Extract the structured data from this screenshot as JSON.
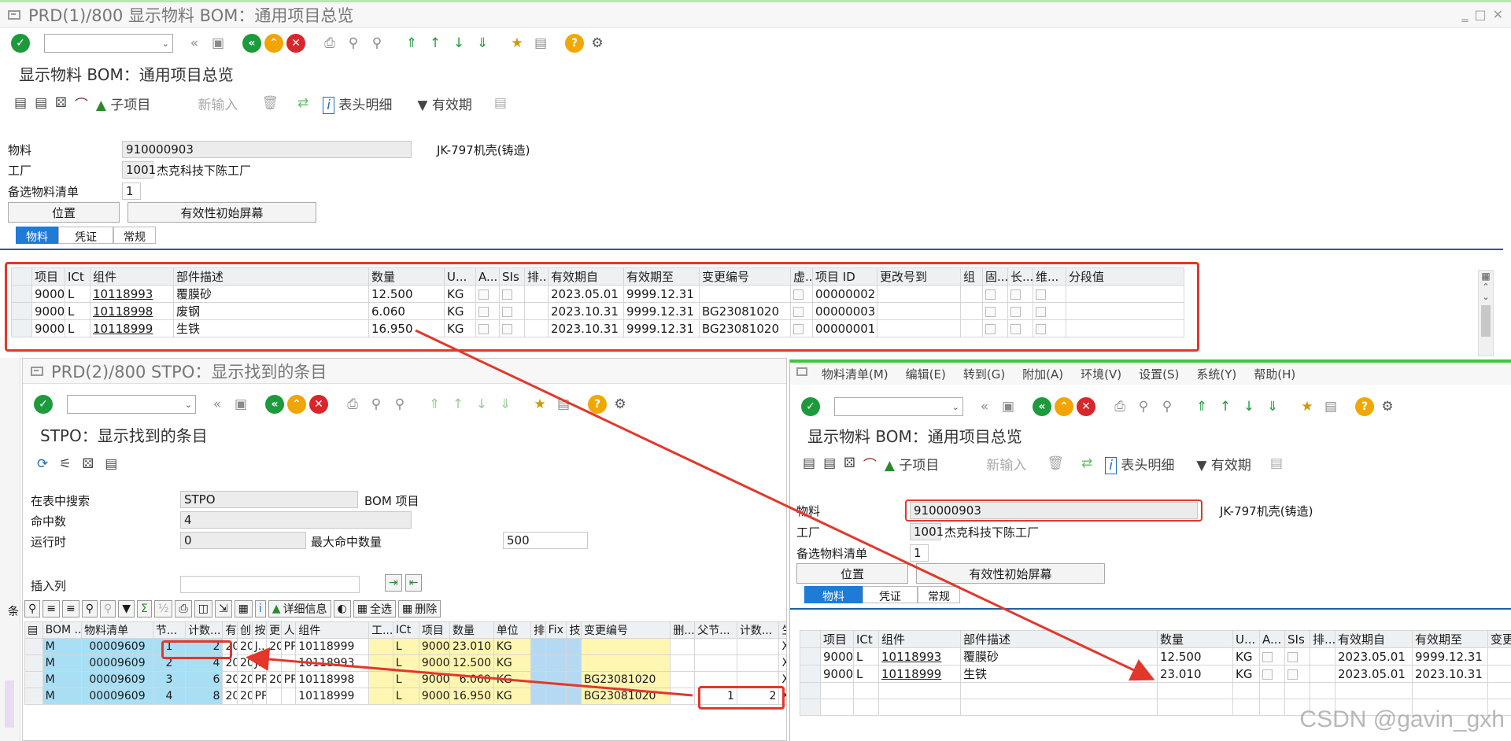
{
  "win1": {
    "title": "PRD(1)/800 显示物料 BOM：通用项目总览",
    "page_title": "显示物料 BOM：通用项目总览",
    "app_toolbar": {
      "sub_item": "子项目",
      "new_entry": "新输入",
      "header_detail": "表头明细",
      "validity": "有效期"
    },
    "material_label": "物料",
    "material_value": "910000903",
    "material_desc": "JK-797机壳(铸造)",
    "plant_label": "工厂",
    "plant_value": "1001",
    "plant_desc": "杰克科技下陈工厂",
    "alt_bom_label": "备选物料清单",
    "alt_bom_value": "1",
    "btn_position": "位置",
    "btn_validity": "有效性初始屏幕",
    "tabs": [
      "物料",
      "凭证",
      "常规"
    ],
    "columns": [
      "项目",
      "ICt",
      "组件",
      "部件描述",
      "数量",
      "U...",
      "A...",
      "SIs",
      "排...",
      "有效期自",
      "有效期至",
      "变更编号",
      "虚...",
      "项目 ID",
      "更改号到",
      "组",
      "固...",
      "长...",
      "维...",
      "分段值"
    ],
    "rows": [
      {
        "item": "9000",
        "ict": "L",
        "comp": "10118993",
        "desc": "覆膜砂",
        "qty": "12.500",
        "unit": "KG",
        "from": "2023.05.01",
        "to": "9999.12.31",
        "change": "",
        "id": "00000002"
      },
      {
        "item": "9000",
        "ict": "L",
        "comp": "10118998",
        "desc": "废钢",
        "qty": "6.060",
        "unit": "KG",
        "from": "2023.10.31",
        "to": "9999.12.31",
        "change": "BG23081020",
        "id": "00000003"
      },
      {
        "item": "9000",
        "ict": "L",
        "comp": "10118999",
        "desc": "生铁",
        "qty": "16.950",
        "unit": "KG",
        "from": "2023.10.31",
        "to": "9999.12.31",
        "change": "BG23081020",
        "id": "00000001"
      }
    ],
    "side_label": "条"
  },
  "win2": {
    "title": "PRD(2)/800 STPO：显示找到的条目",
    "page_title": "STPO：显示找到的条目",
    "search_table_label": "在表中搜索",
    "search_table_value": "STPO",
    "search_table_desc": "BOM 项目",
    "hits_label": "命中数",
    "hits_value": "4",
    "runtime_label": "运行时",
    "runtime_value": "0",
    "max_hits_label": "最大命中数量",
    "max_hits_value": "500",
    "insert_col_label": "插入列",
    "grid_buttons": {
      "detail": "详细信息",
      "select_all": "全选",
      "delete": "删除"
    },
    "columns": [
      "BOM ...",
      "物料清单",
      "节...",
      "计数...",
      "有",
      "创",
      "按",
      "更",
      "人",
      "组件",
      "工...",
      "ICt",
      "项目",
      "数量",
      "单位",
      "排",
      "Fix",
      "技",
      "变更编号",
      "删...",
      "父节...",
      "计数...",
      "生"
    ],
    "rows": [
      {
        "bom": "M",
        "list": "00009609",
        "node": "1",
        "count": "2",
        "c1": "20",
        "c2": "20",
        "c3": "J..",
        "c4": "20",
        "c5": "PP",
        "comp": "10118999",
        "ict": "L",
        "item": "9000",
        "qty": "23.010",
        "unit": "KG",
        "change": "",
        "parent": "",
        "pcount": "",
        "x": "X"
      },
      {
        "bom": "M",
        "list": "00009609",
        "node": "2",
        "count": "4",
        "c1": "20",
        "c2": "20",
        "c3": "J..",
        "c4": "",
        "c5": "",
        "comp": "10118993",
        "ict": "L",
        "item": "9000",
        "qty": "12.500",
        "unit": "KG",
        "change": "",
        "parent": "",
        "pcount": "",
        "x": "X"
      },
      {
        "bom": "M",
        "list": "00009609",
        "node": "3",
        "count": "6",
        "c1": "20",
        "c2": "20",
        "c3": "PP",
        "c4": "20",
        "c5": "PP",
        "comp": "10118998",
        "ict": "L",
        "item": "9000",
        "qty": "6.060",
        "unit": "KG",
        "change": "BG23081020",
        "parent": "",
        "pcount": "",
        "x": "X"
      },
      {
        "bom": "M",
        "list": "00009609",
        "node": "4",
        "count": "8",
        "c1": "20",
        "c2": "20",
        "c3": "PP",
        "c4": "",
        "c5": "",
        "comp": "10118999",
        "ict": "L",
        "item": "9000",
        "qty": "16.950",
        "unit": "KG",
        "change": "BG23081020",
        "parent": "1",
        "pcount": "2",
        "x": "X"
      }
    ]
  },
  "win3": {
    "menu": [
      "物料清单(M)",
      "编辑(E)",
      "转到(G)",
      "附加(A)",
      "环境(V)",
      "设置(S)",
      "系统(Y)",
      "帮助(H)"
    ],
    "page_title": "显示物料 BOM：通用项目总览",
    "app_toolbar": {
      "sub_item": "子项目",
      "new_entry": "新输入",
      "header_detail": "表头明细",
      "validity": "有效期"
    },
    "material_label": "物料",
    "material_value": "910000903",
    "material_desc": "JK-797机壳(铸造)",
    "plant_label": "工厂",
    "plant_value": "1001",
    "plant_desc": "杰克科技下陈工厂",
    "alt_bom_label": "备选物料清单",
    "alt_bom_value": "1",
    "btn_position": "位置",
    "btn_validity": "有效性初始屏幕",
    "tabs": [
      "物料",
      "凭证",
      "常规"
    ],
    "columns": [
      "项目",
      "ICt",
      "组件",
      "部件描述",
      "数量",
      "U...",
      "A...",
      "SIs",
      "排...",
      "有效期自",
      "有效期至",
      "变更"
    ],
    "rows": [
      {
        "item": "9000",
        "ict": "L",
        "comp": "10118993",
        "desc": "覆膜砂",
        "qty": "12.500",
        "unit": "KG",
        "from": "2023.05.01",
        "to": "9999.12.31"
      },
      {
        "item": "9000",
        "ict": "L",
        "comp": "10118999",
        "desc": "生铁",
        "qty": "23.010",
        "unit": "KG",
        "from": "2023.05.01",
        "to": "2023.10.31"
      }
    ]
  },
  "watermark": "CSDN @gavin_gxh",
  "colors": {
    "annotation_red": "#e2372b",
    "tab_active": "#1e7bd6",
    "win3_accent": "#3cc83c"
  }
}
